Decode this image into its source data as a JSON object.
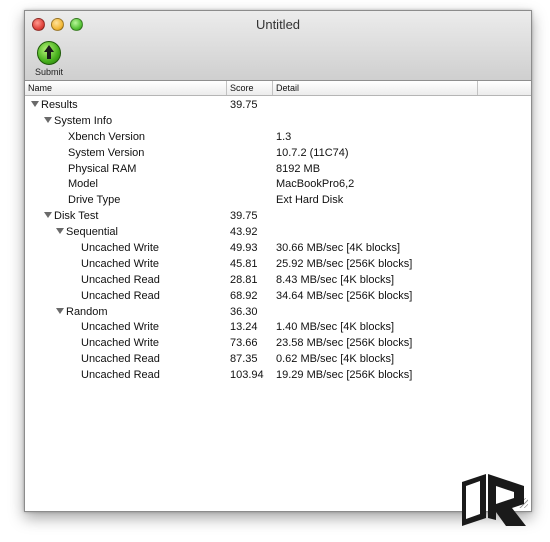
{
  "window": {
    "title": "Untitled"
  },
  "toolbar": {
    "submit_label": "Submit"
  },
  "table": {
    "headers": {
      "name": "Name",
      "score": "Score",
      "detail": "Detail"
    },
    "rows": [
      {
        "name": "Results",
        "score": "39.75",
        "detail": ""
      },
      {
        "name": "System Info",
        "score": "",
        "detail": ""
      },
      {
        "name": "Xbench Version",
        "score": "",
        "detail": "1.3"
      },
      {
        "name": "System Version",
        "score": "",
        "detail": "10.7.2 (11C74)"
      },
      {
        "name": "Physical RAM",
        "score": "",
        "detail": "8192 MB"
      },
      {
        "name": "Model",
        "score": "",
        "detail": "MacBookPro6,2"
      },
      {
        "name": "Drive Type",
        "score": "",
        "detail": "Ext Hard Disk"
      },
      {
        "name": "Disk Test",
        "score": "39.75",
        "detail": ""
      },
      {
        "name": "Sequential",
        "score": "43.92",
        "detail": ""
      },
      {
        "name": "Uncached Write",
        "score": "49.93",
        "detail": "30.66 MB/sec [4K blocks]"
      },
      {
        "name": "Uncached Write",
        "score": "45.81",
        "detail": "25.92 MB/sec [256K blocks]"
      },
      {
        "name": "Uncached Read",
        "score": "28.81",
        "detail": "8.43 MB/sec [4K blocks]"
      },
      {
        "name": "Uncached Read",
        "score": "68.92",
        "detail": "34.64 MB/sec [256K blocks]"
      },
      {
        "name": "Random",
        "score": "36.30",
        "detail": ""
      },
      {
        "name": "Uncached Write",
        "score": "13.24",
        "detail": "1.40 MB/sec [4K blocks]"
      },
      {
        "name": "Uncached Write",
        "score": "73.66",
        "detail": "23.58 MB/sec [256K blocks]"
      },
      {
        "name": "Uncached Read",
        "score": "87.35",
        "detail": "0.62 MB/sec [4K blocks]"
      },
      {
        "name": "Uncached Read",
        "score": "103.94",
        "detail": "19.29 MB/sec [256K blocks]"
      }
    ]
  },
  "logo": {
    "text": "LR",
    "color": "#1a1a1a"
  },
  "icons": {
    "submit": "upload-arrow-icon",
    "disclosure": "disclosure-triangle-icon"
  }
}
